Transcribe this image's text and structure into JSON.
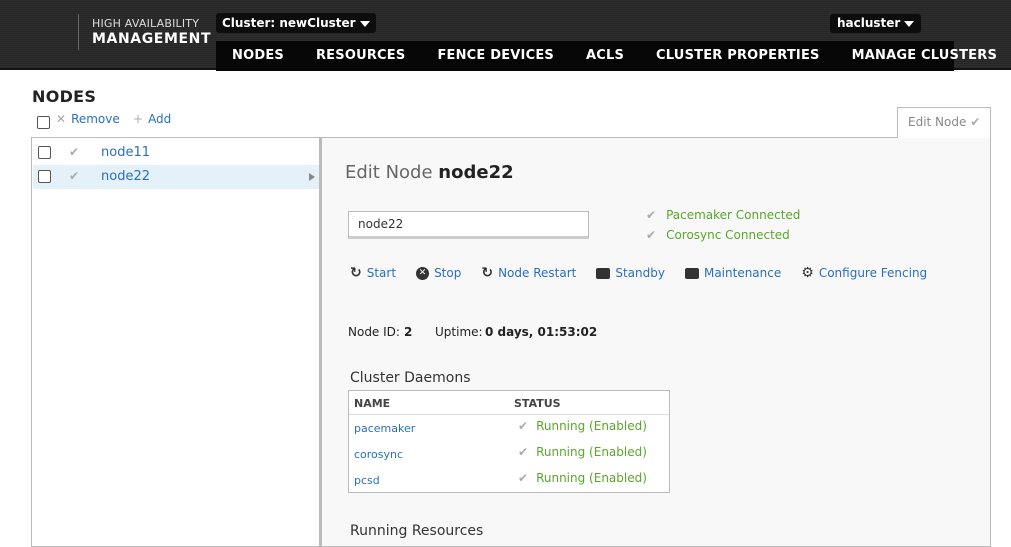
{
  "header": {
    "logo_line1": "HIGH AVAILABILITY",
    "logo_line2": "MANAGEMENT",
    "cluster_selector": "Cluster: newCluster",
    "user": "hacluster",
    "nav": [
      "NODES",
      "RESOURCES",
      "FENCE DEVICES",
      "ACLS",
      "CLUSTER PROPERTIES",
      "MANAGE CLUSTERS"
    ],
    "active_nav": "NODES"
  },
  "nodes_page": {
    "title": "NODES",
    "remove_label": "Remove",
    "add_label": "Add",
    "nodes": [
      {
        "name": "node11",
        "selected": false
      },
      {
        "name": "node22",
        "selected": true
      }
    ]
  },
  "edit_panel": {
    "tab_label": "Edit Node",
    "title_prefix": "Edit Node",
    "title_name": "node22",
    "node_name_value": "node22",
    "statuses": [
      "Pacemaker Connected",
      "Corosync Connected"
    ],
    "actions": [
      "Start",
      "Stop",
      "Node Restart",
      "Standby",
      "Maintenance",
      "Configure Fencing"
    ],
    "node_id_label": "Node ID:",
    "node_id": "2",
    "uptime_label": "Uptime:",
    "uptime": "0 days, 01:53:02",
    "daemons_heading": "Cluster Daemons",
    "daemons_columns": [
      "NAME",
      "STATUS"
    ],
    "daemons": [
      {
        "name": "pacemaker",
        "status": "Running (Enabled)"
      },
      {
        "name": "corosync",
        "status": "Running (Enabled)"
      },
      {
        "name": "pcsd",
        "status": "Running (Enabled)"
      }
    ],
    "running_heading": "Running Resources"
  },
  "colors": {
    "link": "#2a6fbf",
    "success": "#5aa62c",
    "header_bg": "#2a2a2a",
    "selected_row": "#e4f1f9"
  }
}
